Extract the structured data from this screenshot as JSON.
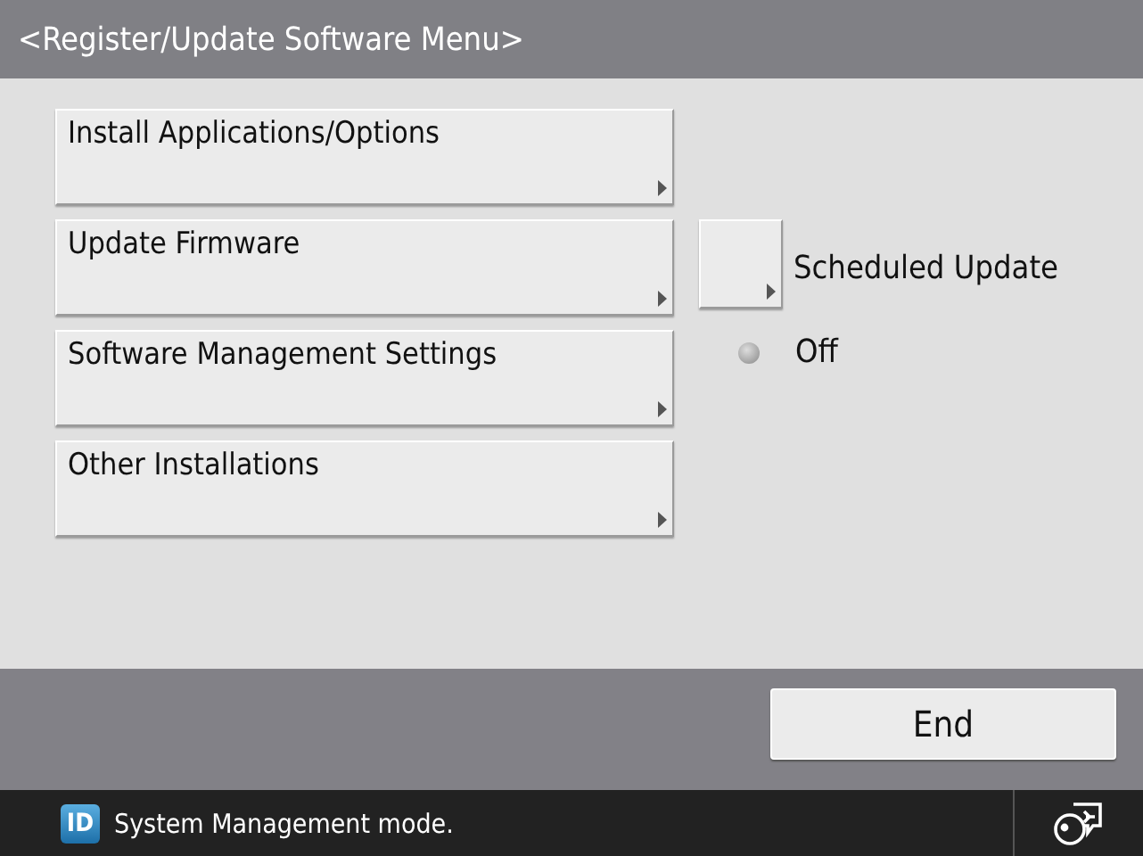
{
  "window": {
    "title": "<Register/Update Software Menu>"
  },
  "menu_buttons": [
    {
      "label": "Install Applications/Options"
    },
    {
      "label": "Update Firmware"
    },
    {
      "label": "Software Management Settings"
    },
    {
      "label": "Other Installations"
    }
  ],
  "scheduled_update": {
    "label": "Scheduled Update",
    "status": "Off",
    "on": false
  },
  "footer": {
    "end_button": "End"
  },
  "status_bar": {
    "badge": "ID",
    "message": "System Management mode."
  }
}
